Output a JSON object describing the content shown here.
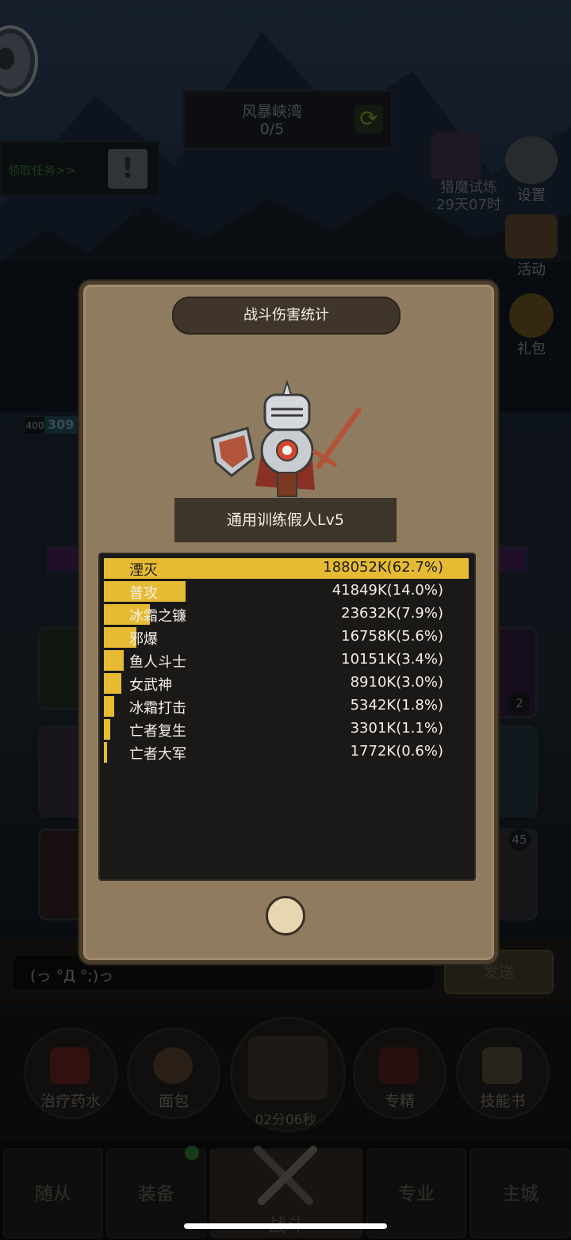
{
  "hud": {
    "zone_name": "风暴峡湾",
    "zone_progress": "0/5",
    "quest_label": "领取任务>>",
    "hunt_title": "猎魔试炼",
    "hunt_timer": "29天07时",
    "settings_label": "设置",
    "activity_label": "活动",
    "gift_label": "礼包",
    "level_badge": "400",
    "hp_value": "309"
  },
  "side_badges": [
    "2",
    "45"
  ],
  "modal": {
    "title": "战斗伤害统计",
    "target_name": "通用训练假人Lv5",
    "rows": [
      {
        "name": "湮灭",
        "value": "188052K(62.7%)",
        "share": 62.7
      },
      {
        "name": "普攻",
        "value": "41849K(14.0%)",
        "share": 14.0
      },
      {
        "name": "冰霜之镰",
        "value": "23632K(7.9%)",
        "share": 7.9
      },
      {
        "name": "邪爆",
        "value": "16758K(5.6%)",
        "share": 5.6
      },
      {
        "name": "鱼人斗士",
        "value": "10151K(3.4%)",
        "share": 3.4
      },
      {
        "name": "女武神",
        "value": "8910K(3.0%)",
        "share": 3.0
      },
      {
        "name": "冰霜打击",
        "value": "5342K(1.8%)",
        "share": 1.8
      },
      {
        "name": "亡者复生",
        "value": "3301K(1.1%)",
        "share": 1.1
      },
      {
        "name": "亡者大军",
        "value": "1772K(0.6%)",
        "share": 0.6
      }
    ]
  },
  "chat": {
    "input_text": "(っ °Д °;)っ",
    "send_label": "发送"
  },
  "items": {
    "potion": "治疗药水",
    "bread": "面包",
    "timer": "02分06秒",
    "mastery": "专精",
    "skillbook": "技能书"
  },
  "tabs": {
    "follower": "随从",
    "equipment": "装备",
    "battle": "战斗",
    "profession": "专业",
    "main_city": "主城"
  },
  "colors": {
    "bar_fill": "#e6bb33",
    "modal_bg": "#8f7c60",
    "panel_bg": "#1b1917"
  }
}
